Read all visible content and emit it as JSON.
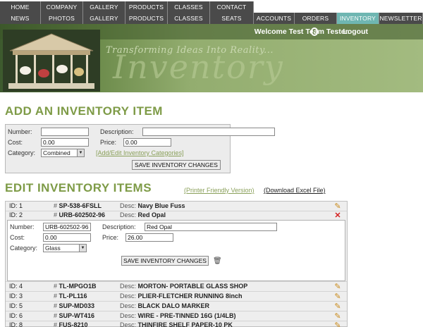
{
  "nav": {
    "row1": [
      "HOME",
      "COMPANY",
      "GALLERY",
      "PRODUCTS",
      "CLASSES",
      "CONTACT"
    ],
    "row2": [
      "NEWS",
      "PHOTOS",
      "GALLERY",
      "PRODUCTS",
      "CLASSES",
      "SEATS",
      "ACCOUNTS",
      "ORDERS",
      "INVENTORY",
      "NEWSLETTER"
    ],
    "active": "INVENTORY"
  },
  "banner": {
    "welcome": "Welcome Test Team Tester.",
    "logout": "Logout",
    "tagline": "Transforming Ideas Into Reality...",
    "title": "Inventory"
  },
  "add_section": {
    "heading": "ADD AN INVENTORY ITEM",
    "labels": {
      "number": "Number:",
      "description": "Description:",
      "cost": "Cost:",
      "price": "Price:",
      "category": "Category:"
    },
    "values": {
      "number": "",
      "description": "",
      "cost": "0.00",
      "price": "0.00",
      "category": "Combined"
    },
    "categories_link": "[Add/Edit Inventory Categories]",
    "save_label": "SAVE INVENTORY CHANGES"
  },
  "edit_section": {
    "heading": "EDIT INVENTORY ITEMS",
    "printer_link": "(Printer Friendly Version)",
    "excel_link": "(Download Excel File)",
    "id_prefix": "ID:",
    "sku_prefix": "#",
    "desc_prefix": "Desc:",
    "rows_top": [
      {
        "id": "1",
        "sku": "SP-538-6FSLL",
        "desc": "Navy Blue Fuss",
        "action": "edit"
      },
      {
        "id": "2",
        "sku": "URB-602502-96",
        "desc": "Red Opal",
        "action": "delete"
      }
    ],
    "editing": {
      "labels": {
        "number": "Number:",
        "description": "Description:",
        "cost": "Cost:",
        "price": "Price:",
        "category": "Category:"
      },
      "values": {
        "number": "URB-602502-96",
        "description": "Red Opal",
        "cost": "0.00",
        "price": "26.00",
        "category": "Glass"
      },
      "save_label": "SAVE INVENTORY CHANGES"
    },
    "rows_bottom": [
      {
        "id": "4",
        "sku": "TL-MPGO1B",
        "desc": "MORTON- PORTABLE GLASS SHOP"
      },
      {
        "id": "3",
        "sku": "TL-PL116",
        "desc": "PLIER-FLETCHER RUNNING 8inch"
      },
      {
        "id": "5",
        "sku": "SUP-MD033",
        "desc": "BLACK DALO MARKER"
      },
      {
        "id": "6",
        "sku": "SUP-WT416",
        "desc": "WIRE - PRE-TINNED 16G (1/4LB)"
      },
      {
        "id": "8",
        "sku": "FUS-8210",
        "desc": "THINFIRE SHELF PAPER-10 PK"
      }
    ]
  },
  "colors": {
    "heading": "#7e9b47",
    "nav_bg": "#4a4a4a",
    "nav_active": "#6fb6b2",
    "pencil": "#c98a1a",
    "delete": "#d42020"
  }
}
